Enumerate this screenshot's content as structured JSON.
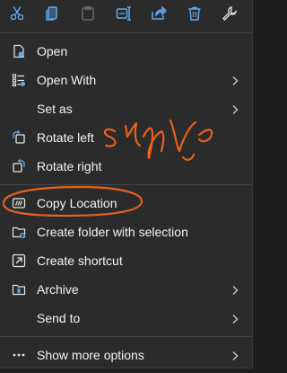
{
  "toolbar": {
    "buttons": [
      {
        "icon": "cut-icon"
      },
      {
        "icon": "copy-icon"
      },
      {
        "icon": "paste-icon"
      },
      {
        "icon": "rename-icon"
      },
      {
        "icon": "share-icon"
      },
      {
        "icon": "delete-icon"
      },
      {
        "icon": "properties-icon"
      }
    ]
  },
  "menu": {
    "open": "Open",
    "open_with": "Open With",
    "set_as": "Set as",
    "rotate_left": "Rotate left",
    "rotate_right": "Rotate right",
    "copy_location": "Copy Location",
    "create_folder": "Create folder with selection",
    "create_shortcut": "Create shortcut",
    "archive": "Archive",
    "send_to": "Send to",
    "show_more": "Show more options"
  },
  "annotation": {
    "handwritten_text": "Single",
    "color": "#e8601c"
  },
  "colors": {
    "accent_blue": "#60a8e8",
    "background": "#2b2b2b"
  }
}
